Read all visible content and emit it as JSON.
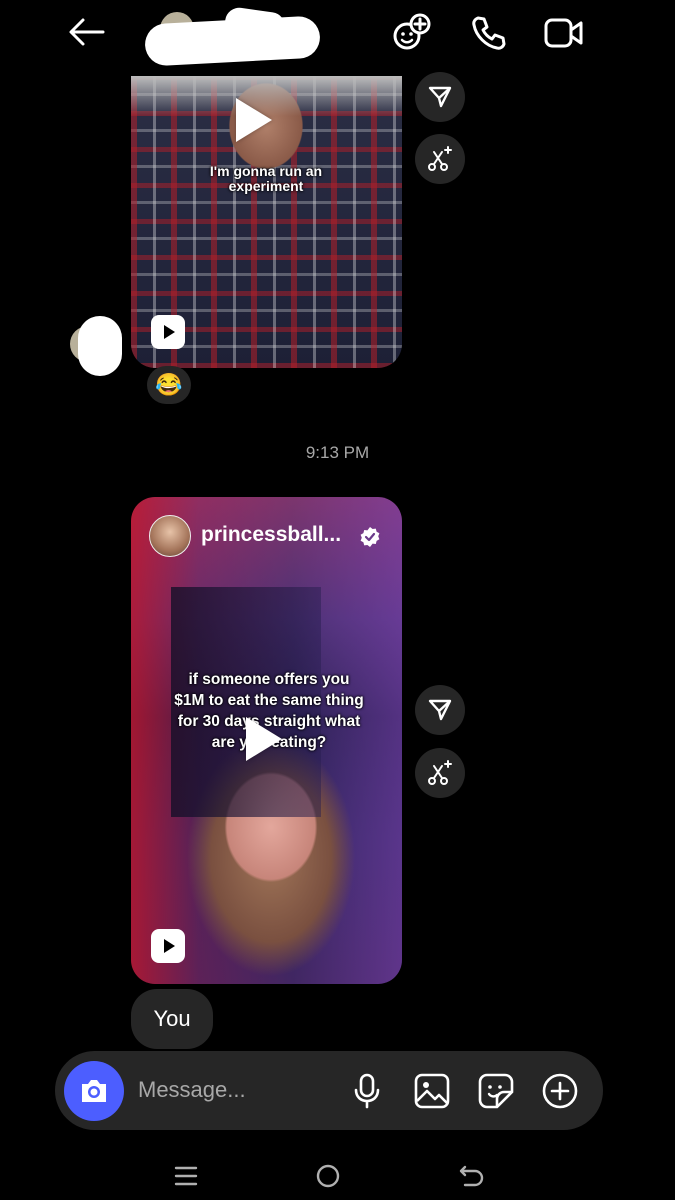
{
  "header": {
    "back_icon": "arrow-left-icon",
    "contact_name_redacted": true,
    "actions": [
      "effects-icon",
      "phone-icon",
      "video-icon"
    ]
  },
  "messages": [
    {
      "type": "reel",
      "overlay_text": "I'm gonna run an experiment",
      "reaction": "😂"
    },
    {
      "type": "timestamp",
      "text": "9:13 PM"
    },
    {
      "type": "reel",
      "author": "princessball...",
      "verified": true,
      "overlay_text_lines": [
        "if someone offers you",
        "$1M to eat the same thing",
        "for 30 days straight what",
        "are you eating?"
      ]
    },
    {
      "type": "text",
      "text": "You"
    }
  ],
  "composer": {
    "placeholder": "Message...",
    "icons": [
      "camera-icon",
      "microphone-icon",
      "gallery-icon",
      "sticker-icon",
      "plus-icon"
    ]
  },
  "colors": {
    "background": "#000000",
    "bubble": "#262626",
    "accent": "#4c5eff",
    "muted_text": "#a8a8a8"
  }
}
